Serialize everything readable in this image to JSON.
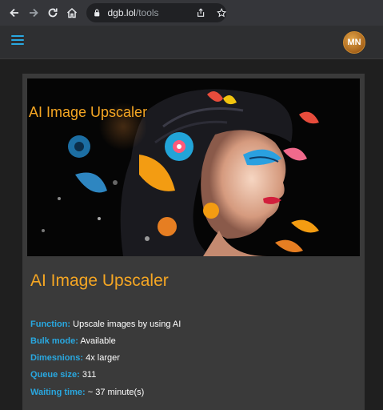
{
  "browser": {
    "url_host": "dgb.lol",
    "url_path": "/tools"
  },
  "header": {
    "avatar_initials": "MN"
  },
  "tool": {
    "hero_title": "AI Image Upscaler",
    "title": "AI Image Upscaler",
    "details": [
      {
        "key": "Function:",
        "value": "Upscale images by using AI"
      },
      {
        "key": "Bulk mode:",
        "value": "Available"
      },
      {
        "key": "Dimesnions:",
        "value": "4x larger"
      },
      {
        "key": "Queue size:",
        "value": "311"
      },
      {
        "key": "Waiting time:",
        "value": "~ 37 minute(s)"
      }
    ]
  },
  "colors": {
    "accent_blue": "#29a8e0",
    "accent_orange": "#f5a623"
  }
}
